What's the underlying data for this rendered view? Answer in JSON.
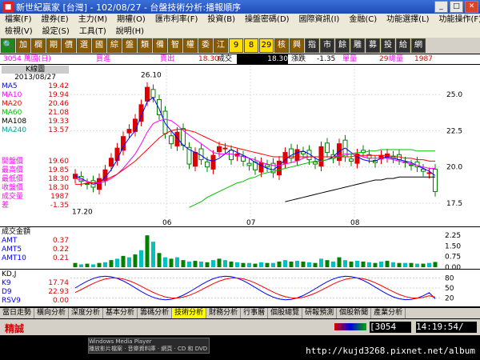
{
  "window": {
    "title": "新世紀贏家 [台灣] - 102/08/27 - 台盤技術分析:播報順序"
  },
  "menu": {
    "row1": [
      "檔案(F)",
      "證券(E)",
      "主力(M)",
      "期權(O)",
      "匯市利率(F)",
      "投資(B)",
      "操盤密碼(D)",
      "國際資訊(I)",
      "金融(C)",
      "功能選擇(L)",
      "功能操作(F)"
    ],
    "row2": [
      "檢視(V)",
      "設定(S)",
      "工具(T)",
      "說明(H)"
    ]
  },
  "toolbar": [
    "加",
    "欄",
    "期",
    "價",
    "選",
    "國",
    "綜",
    "盤",
    "類",
    "備",
    "智",
    "權",
    "委",
    "江",
    "9",
    "8",
    "29",
    "核",
    "興",
    "指",
    "市",
    "餘",
    "雕",
    "募",
    "投",
    "給",
    "網"
  ],
  "quote": {
    "code_name": "3054 萬國(日)",
    "buy_label": "買進",
    "sell_label": "賣出",
    "price": "18.30",
    "deal_label": "成交",
    "deal": "18.30",
    "change_label": "漲跌",
    "change": "-1.35",
    "vol_label": "單量",
    "vol": "29",
    "total_label": "總量",
    "total": "1987"
  },
  "kline": {
    "header": "K線圖",
    "date": "2013/08/27",
    "ma": [
      {
        "name": "MA5",
        "value": "19.42",
        "color": "#0000ff"
      },
      {
        "name": "MA10",
        "value": "19.94",
        "color": "#ff00ff"
      },
      {
        "name": "MA20",
        "value": "20.46",
        "color": "#ff0000"
      },
      {
        "name": "MA60",
        "value": "21.08",
        "color": "#00c000"
      },
      {
        "name": "MA108",
        "value": "19.33",
        "color": "#000000"
      },
      {
        "name": "MA240",
        "value": "13.57",
        "color": "#00a0a0"
      }
    ],
    "prices": [
      {
        "name": "開盤價",
        "value": "19.60"
      },
      {
        "name": "最高價",
        "value": "19.85"
      },
      {
        "name": "最低價",
        "value": "18.30"
      },
      {
        "name": "收盤價",
        "value": "18.30"
      },
      {
        "name": "成交量",
        "value": "1987"
      },
      {
        "name": "差",
        "value": "-1.35"
      }
    ],
    "high_label": "26.10",
    "low_label": "17.20",
    "y_ticks": [
      "25.0",
      "22.5",
      "20.0",
      "17.5"
    ],
    "x_ticks": [
      "06",
      "07",
      "08"
    ]
  },
  "amount": {
    "header": "成交金額",
    "items": [
      {
        "name": "AMT",
        "value": "0.37"
      },
      {
        "name": "AMT5",
        "value": "0.22"
      },
      {
        "name": "AMT10",
        "value": "0.21"
      }
    ],
    "y_ticks": [
      "2.25",
      "1.50",
      "0.75",
      "0.00"
    ]
  },
  "kd": {
    "header": "KD,J",
    "items": [
      {
        "name": "K9",
        "value": "17.74"
      },
      {
        "name": "D9",
        "value": "22.93"
      },
      {
        "name": "RSV9",
        "value": "0.00"
      }
    ],
    "y_ticks": [
      "80",
      "50",
      "20"
    ]
  },
  "tabs": [
    "當日走勢",
    "橫向分析",
    "深度分析",
    "基本分析",
    "籌碼分析",
    "技術分析",
    "財務分析",
    "行事曆",
    "個股總覽",
    "研報預測",
    "個股新聞",
    "產業分析"
  ],
  "active_tab": "技術分析",
  "status": {
    "brand": "精誠",
    "code": "[3054",
    "time": "14:19:54/"
  },
  "taskbar": {
    "wmp_title": "Windows Media Player",
    "wmp_sub": "播放影片檔案 · 音樂資料庫 · 網頁 · CD 和 DVD",
    "url": "http://kujd3268.pixnet.net/album"
  },
  "chart_data": {
    "type": "candlestick",
    "series": [
      {
        "name": "MA5",
        "color": "#0000ff",
        "values": [
          19.4,
          19.2,
          19.0,
          18.8,
          18.9,
          19.3,
          19.8,
          20.5,
          21.4,
          22.0,
          22.5,
          23.5,
          24.5,
          24.8,
          24.0,
          23.0,
          22.5,
          22.0,
          21.5,
          21.2,
          21.0,
          20.8,
          20.5,
          20.4,
          20.6,
          20.9,
          21.2,
          21.0,
          20.8,
          20.6,
          20.3,
          20.1,
          19.9,
          19.8,
          20.1,
          20.5,
          20.8,
          21.0,
          21.1,
          20.9,
          20.6,
          20.4,
          20.5,
          20.7,
          21.1,
          21.3,
          21.0,
          20.7,
          20.5,
          20.4,
          20.4,
          20.6,
          20.7,
          20.6,
          20.5,
          20.4,
          20.3,
          20.1,
          19.9,
          19.7,
          19.4
        ]
      },
      {
        "name": "MA10",
        "color": "#ff00ff",
        "values": [
          19.2,
          19.1,
          19.0,
          18.9,
          18.9,
          19.0,
          19.2,
          19.5,
          19.9,
          20.4,
          20.9,
          21.6,
          22.4,
          23.0,
          23.2,
          23.3,
          23.2,
          22.9,
          22.5,
          22.2,
          21.9,
          21.6,
          21.3,
          21.0,
          20.9,
          20.9,
          20.9,
          20.8,
          20.7,
          20.6,
          20.5,
          20.3,
          20.2,
          20.1,
          20.1,
          20.2,
          20.3,
          20.4,
          20.6,
          20.7,
          20.7,
          20.7,
          20.7,
          20.7,
          20.8,
          20.9,
          20.9,
          20.8,
          20.7,
          20.6,
          20.6,
          20.6,
          20.6,
          20.5,
          20.4,
          20.3,
          20.2,
          20.1,
          20.0,
          19.9,
          19.9
        ]
      },
      {
        "name": "MA20",
        "color": "#ff0000",
        "values": [
          18.8,
          18.8,
          18.9,
          18.9,
          19.0,
          19.1,
          19.3,
          19.5,
          19.8,
          20.1,
          20.4,
          20.8,
          21.2,
          21.6,
          22.0,
          22.3,
          22.5,
          22.6,
          22.6,
          22.5,
          22.4,
          22.2,
          22.0,
          21.8,
          21.6,
          21.5,
          21.4,
          21.3,
          21.2,
          21.1,
          21.0,
          20.9,
          20.8,
          20.7,
          20.7,
          20.7,
          20.7,
          20.7,
          20.7,
          20.7,
          20.7,
          20.7,
          20.7,
          20.7,
          20.7,
          20.7,
          20.7,
          20.8,
          20.8,
          20.8,
          20.8,
          20.8,
          20.8,
          20.7,
          20.7,
          20.6,
          20.6,
          20.5,
          20.5,
          20.4,
          20.4
        ]
      },
      {
        "name": "MA60",
        "color": "#00c000",
        "values": [
          null,
          null,
          null,
          null,
          null,
          null,
          null,
          null,
          null,
          null,
          null,
          null,
          null,
          null,
          null,
          null,
          null,
          null,
          null,
          17.2,
          17.4,
          17.6,
          17.9,
          18.1,
          18.3,
          18.5,
          18.7,
          18.9,
          19.0,
          19.2,
          19.3,
          19.5,
          19.6,
          19.7,
          19.8,
          19.9,
          20.0,
          20.1,
          20.2,
          20.3,
          20.4,
          20.4,
          20.5,
          20.6,
          20.7,
          20.8,
          20.9,
          21.0,
          21.0,
          21.1,
          21.1,
          21.2,
          21.2,
          21.2,
          21.2,
          21.2,
          21.2,
          21.1,
          21.1,
          21.1,
          21.1
        ]
      },
      {
        "name": "MA108",
        "color": "#000000",
        "values": [
          null,
          null,
          null,
          null,
          null,
          null,
          null,
          null,
          null,
          null,
          null,
          null,
          null,
          null,
          null,
          null,
          null,
          null,
          null,
          null,
          null,
          null,
          null,
          null,
          null,
          null,
          null,
          null,
          null,
          null,
          null,
          null,
          null,
          null,
          null,
          17.6,
          17.7,
          17.8,
          17.9,
          18.0,
          18.1,
          18.2,
          18.3,
          18.4,
          18.5,
          18.6,
          18.7,
          18.8,
          18.9,
          19.0,
          19.1,
          19.1,
          19.2,
          19.2,
          19.3,
          19.3,
          19.3,
          19.3,
          19.3,
          19.3,
          19.3
        ]
      }
    ]
  }
}
